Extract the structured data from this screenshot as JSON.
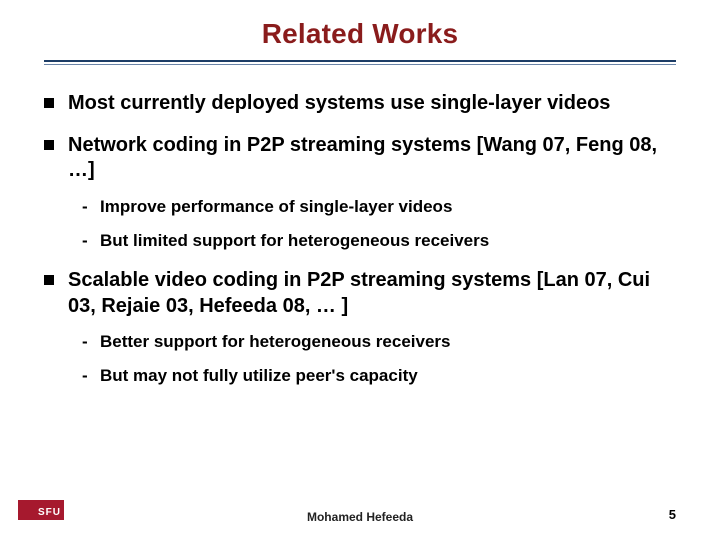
{
  "title": "Related Works",
  "bullets": [
    {
      "text": "Most currently deployed systems use single-layer videos",
      "subs": []
    },
    {
      "text": "Network coding in P2P streaming systems [Wang 07, Feng 08, …]",
      "subs": [
        "Improve performance of single-layer videos",
        "But limited support for heterogeneous receivers"
      ]
    },
    {
      "text": "Scalable video coding in P2P streaming systems [Lan 07, Cui 03, Rejaie 03, Hefeeda 08, … ]",
      "subs": [
        "Better support for heterogeneous receivers",
        "But may not fully utilize peer's capacity"
      ]
    }
  ],
  "footer": {
    "logo_text": "SFU",
    "author": "Mohamed  Hefeeda",
    "page_number": "5"
  }
}
